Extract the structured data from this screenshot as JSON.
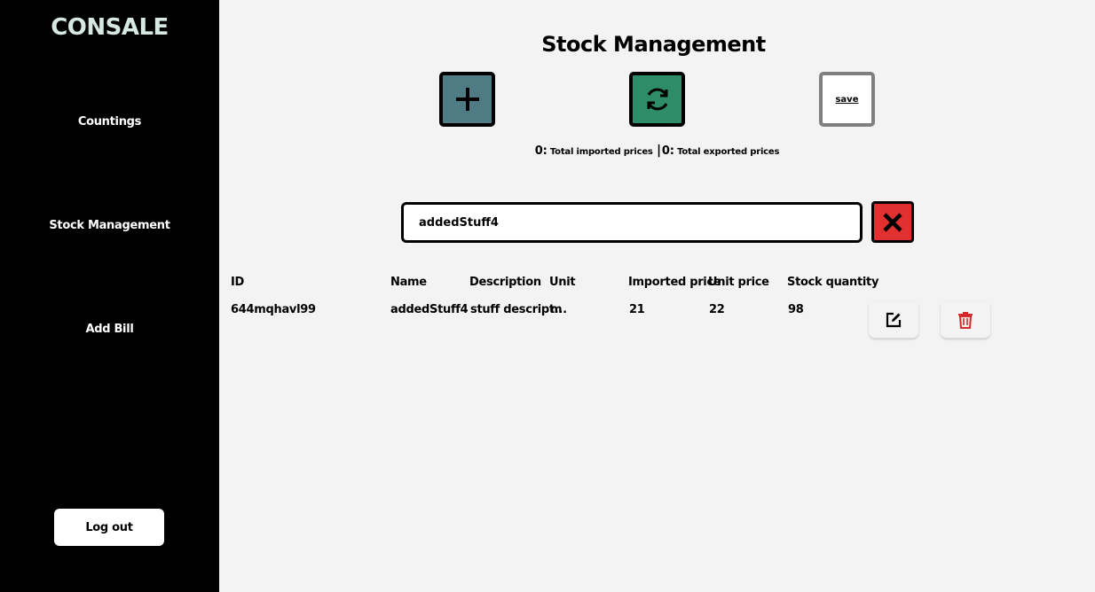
{
  "sidebar": {
    "brand": "CONSALE",
    "items": [
      {
        "label": "Countings"
      },
      {
        "label": "Stock Management"
      },
      {
        "label": "Add Bill"
      }
    ],
    "logout_label": "Log out"
  },
  "main": {
    "title": "Stock Management",
    "toolbar": {
      "add_icon": "plus-icon",
      "refresh_icon": "refresh-icon",
      "save_label": "save",
      "colors": {
        "add": "#4e7b84",
        "refresh": "#2f8c68",
        "clear": "#e03030"
      }
    },
    "totals": {
      "imported_value": "0:",
      "imported_label": "Total imported prices",
      "separator": "|",
      "exported_value": "0:",
      "exported_label": "Total exported prices"
    },
    "search": {
      "value": "addedStuff4"
    },
    "table": {
      "columns": [
        "ID",
        "Name",
        "Description",
        "Unit",
        "Imported price",
        "Unit price",
        "Stock quantity"
      ],
      "rows": [
        {
          "id": "644mqhavl99",
          "name": "addedStuff4",
          "description": "stuff descript...",
          "unit": "m",
          "imported_price": "21",
          "unit_price": "22",
          "stock_quantity": "98"
        }
      ]
    }
  }
}
